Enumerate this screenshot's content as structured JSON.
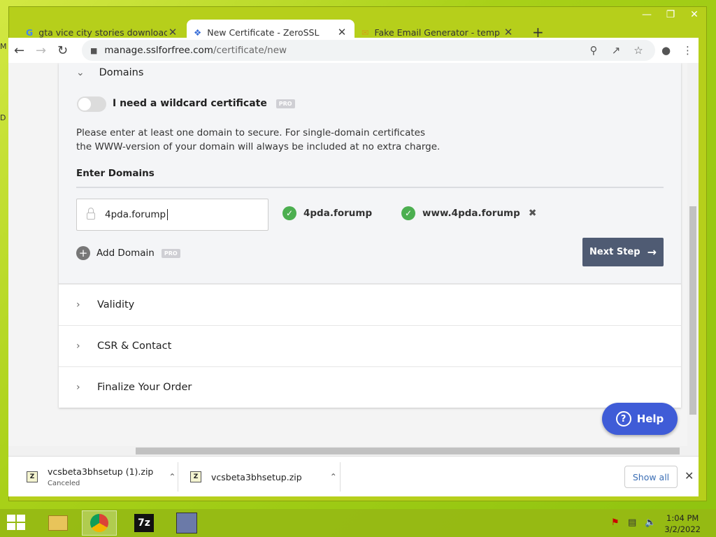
{
  "browser": {
    "tabs": [
      {
        "title": "gta vice city stories download for",
        "icon": "google-icon",
        "active": false
      },
      {
        "title": "New Certificate - ZeroSSL",
        "icon": "puzzle-icon",
        "active": true
      },
      {
        "title": "Fake Email Generator - temp mail",
        "icon": "mail-icon",
        "active": false
      }
    ],
    "new_tab": "+",
    "url_host": "manage.sslforfree.com",
    "url_path": "/certificate/new"
  },
  "page": {
    "domains_title": "Domains",
    "wildcard_label": "I need a wildcard certificate",
    "pro_badge": "PRO",
    "info_line1": "Please enter at least one domain to secure. For single-domain certificates",
    "info_line2": "the WWW-version of your domain will always be included at no extra charge.",
    "enter_domains": "Enter Domains",
    "domain_input_value": "4pda.forump",
    "domains": [
      "4pda.forump",
      "www.4pda.forump"
    ],
    "add_domain": "Add Domain",
    "next_step": "Next Step",
    "sections": [
      "Validity",
      "CSR & Contact",
      "Finalize Your Order"
    ],
    "help": "Help"
  },
  "downloads": [
    {
      "name": "vcsbeta3bhsetup (1).zip",
      "status": "Canceled"
    },
    {
      "name": "vcsbeta3bhsetup.zip",
      "status": ""
    }
  ],
  "downloads_show_all": "Show all",
  "taskbar": {
    "time": "1:04 PM",
    "date": "3/2/2022",
    "zip_label": "7z"
  },
  "colors": {
    "accent": "#4f5b73",
    "help": "#3f5cd7",
    "check": "#4caf50"
  }
}
